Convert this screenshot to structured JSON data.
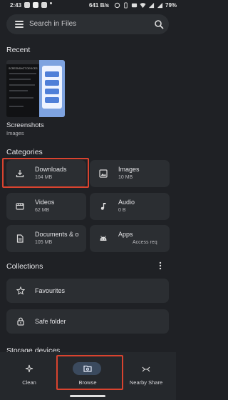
{
  "status_bar": {
    "time": "2:43",
    "speed": "641 B/s",
    "battery": "79%"
  },
  "search": {
    "placeholder": "Search in Files"
  },
  "recent": {
    "heading": "Recent",
    "thumbnail_title": "SCREENSHOT DEVICES",
    "item_title": "Screenshots",
    "item_subtitle": "Images"
  },
  "categories": {
    "heading": "Categories",
    "items": [
      {
        "label": "Downloads",
        "size": "104 MB",
        "icon": "download-icon"
      },
      {
        "label": "Images",
        "size": "10 MB",
        "icon": "image-icon"
      },
      {
        "label": "Videos",
        "size": "62 MB",
        "icon": "video-icon"
      },
      {
        "label": "Audio",
        "size": "0 B",
        "icon": "music-note-icon"
      },
      {
        "label": "Documents & o",
        "size": "105 MB",
        "icon": "document-icon"
      },
      {
        "label": "Apps",
        "size": "Access req",
        "icon": "android-icon"
      }
    ]
  },
  "collections": {
    "heading": "Collections",
    "items": [
      {
        "label": "Favourites",
        "icon": "star-icon"
      },
      {
        "label": "Safe folder",
        "icon": "lock-icon"
      }
    ]
  },
  "storage": {
    "heading": "Storage devices"
  },
  "bottom_nav": {
    "items": [
      {
        "label": "Clean",
        "icon": "sparkle-icon"
      },
      {
        "label": "Browse",
        "icon": "browse-folder-icon",
        "selected": true
      },
      {
        "label": "Nearby Share",
        "icon": "nearby-share-icon"
      }
    ]
  },
  "colors": {
    "background": "#1f2125",
    "card": "#2b2e32",
    "highlight": "#d9432f",
    "selected_pill": "#3b4a5e"
  }
}
